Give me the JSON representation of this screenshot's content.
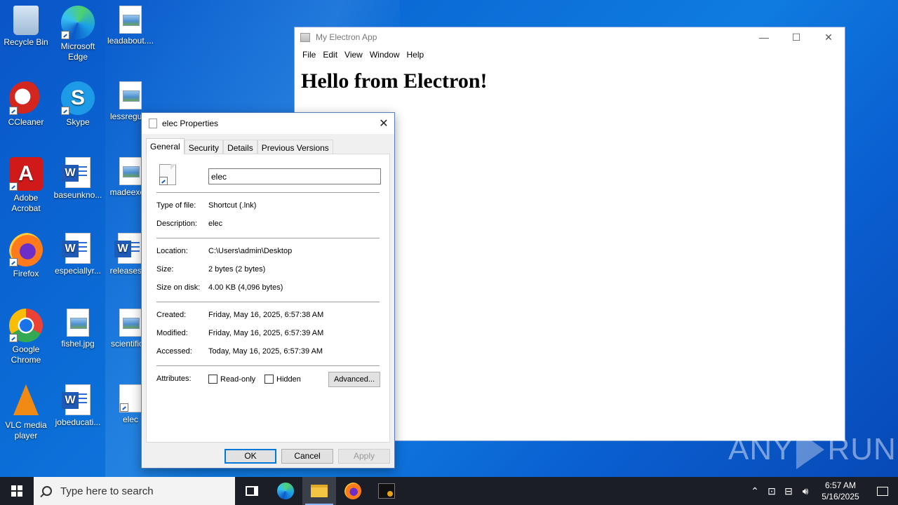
{
  "desktop": {
    "icons": [
      {
        "label": "Recycle Bin"
      },
      {
        "label": "Microsoft Edge"
      },
      {
        "label": "leadabout...."
      },
      {
        "label": "CCleaner"
      },
      {
        "label": "Skype"
      },
      {
        "label": "lessregul..."
      },
      {
        "label": "Adobe Acrobat"
      },
      {
        "label": "baseunkno..."
      },
      {
        "label": "madeexc..."
      },
      {
        "label": "Firefox"
      },
      {
        "label": "especiallyr..."
      },
      {
        "label": "releasest..."
      },
      {
        "label": "Google Chrome"
      },
      {
        "label": "fishel.jpg"
      },
      {
        "label": "scientific..."
      },
      {
        "label": "VLC media player"
      },
      {
        "label": "jobeducati..."
      },
      {
        "label": "elec"
      }
    ]
  },
  "app_window": {
    "title": "My Electron App",
    "menu": [
      "File",
      "Edit",
      "View",
      "Window",
      "Help"
    ],
    "heading": "Hello from Electron!",
    "controls": {
      "minimize": "—",
      "maximize": "☐",
      "close": "✕"
    }
  },
  "properties_dialog": {
    "title": "elec Properties",
    "close": "✕",
    "tabs": [
      "General",
      "Security",
      "Details",
      "Previous Versions"
    ],
    "active_tab": "General",
    "name_value": "elec",
    "rows": {
      "type": {
        "key": "Type of file:",
        "value": "Shortcut (.lnk)"
      },
      "description": {
        "key": "Description:",
        "value": "elec"
      },
      "location": {
        "key": "Location:",
        "value": "C:\\Users\\admin\\Desktop"
      },
      "size": {
        "key": "Size:",
        "value": "2 bytes (2 bytes)"
      },
      "size_on_disk": {
        "key": "Size on disk:",
        "value": "4.00 KB (4,096 bytes)"
      },
      "created": {
        "key": "Created:",
        "value": "Friday, May 16, 2025, 6:57:38 AM"
      },
      "modified": {
        "key": "Modified:",
        "value": "Friday, May 16, 2025, 6:57:39 AM"
      },
      "accessed": {
        "key": "Accessed:",
        "value": "Today, May 16, 2025, 6:57:39 AM"
      }
    },
    "attributes_label": "Attributes:",
    "readonly_label": "Read-only",
    "hidden_label": "Hidden",
    "advanced_label": "Advanced...",
    "ok_label": "OK",
    "cancel_label": "Cancel",
    "apply_label": "Apply"
  },
  "watermark": {
    "left": "ANY",
    "right": "RUN"
  },
  "taskbar": {
    "search_placeholder": "Type here to search",
    "time": "6:57 AM",
    "date": "5/16/2025"
  }
}
